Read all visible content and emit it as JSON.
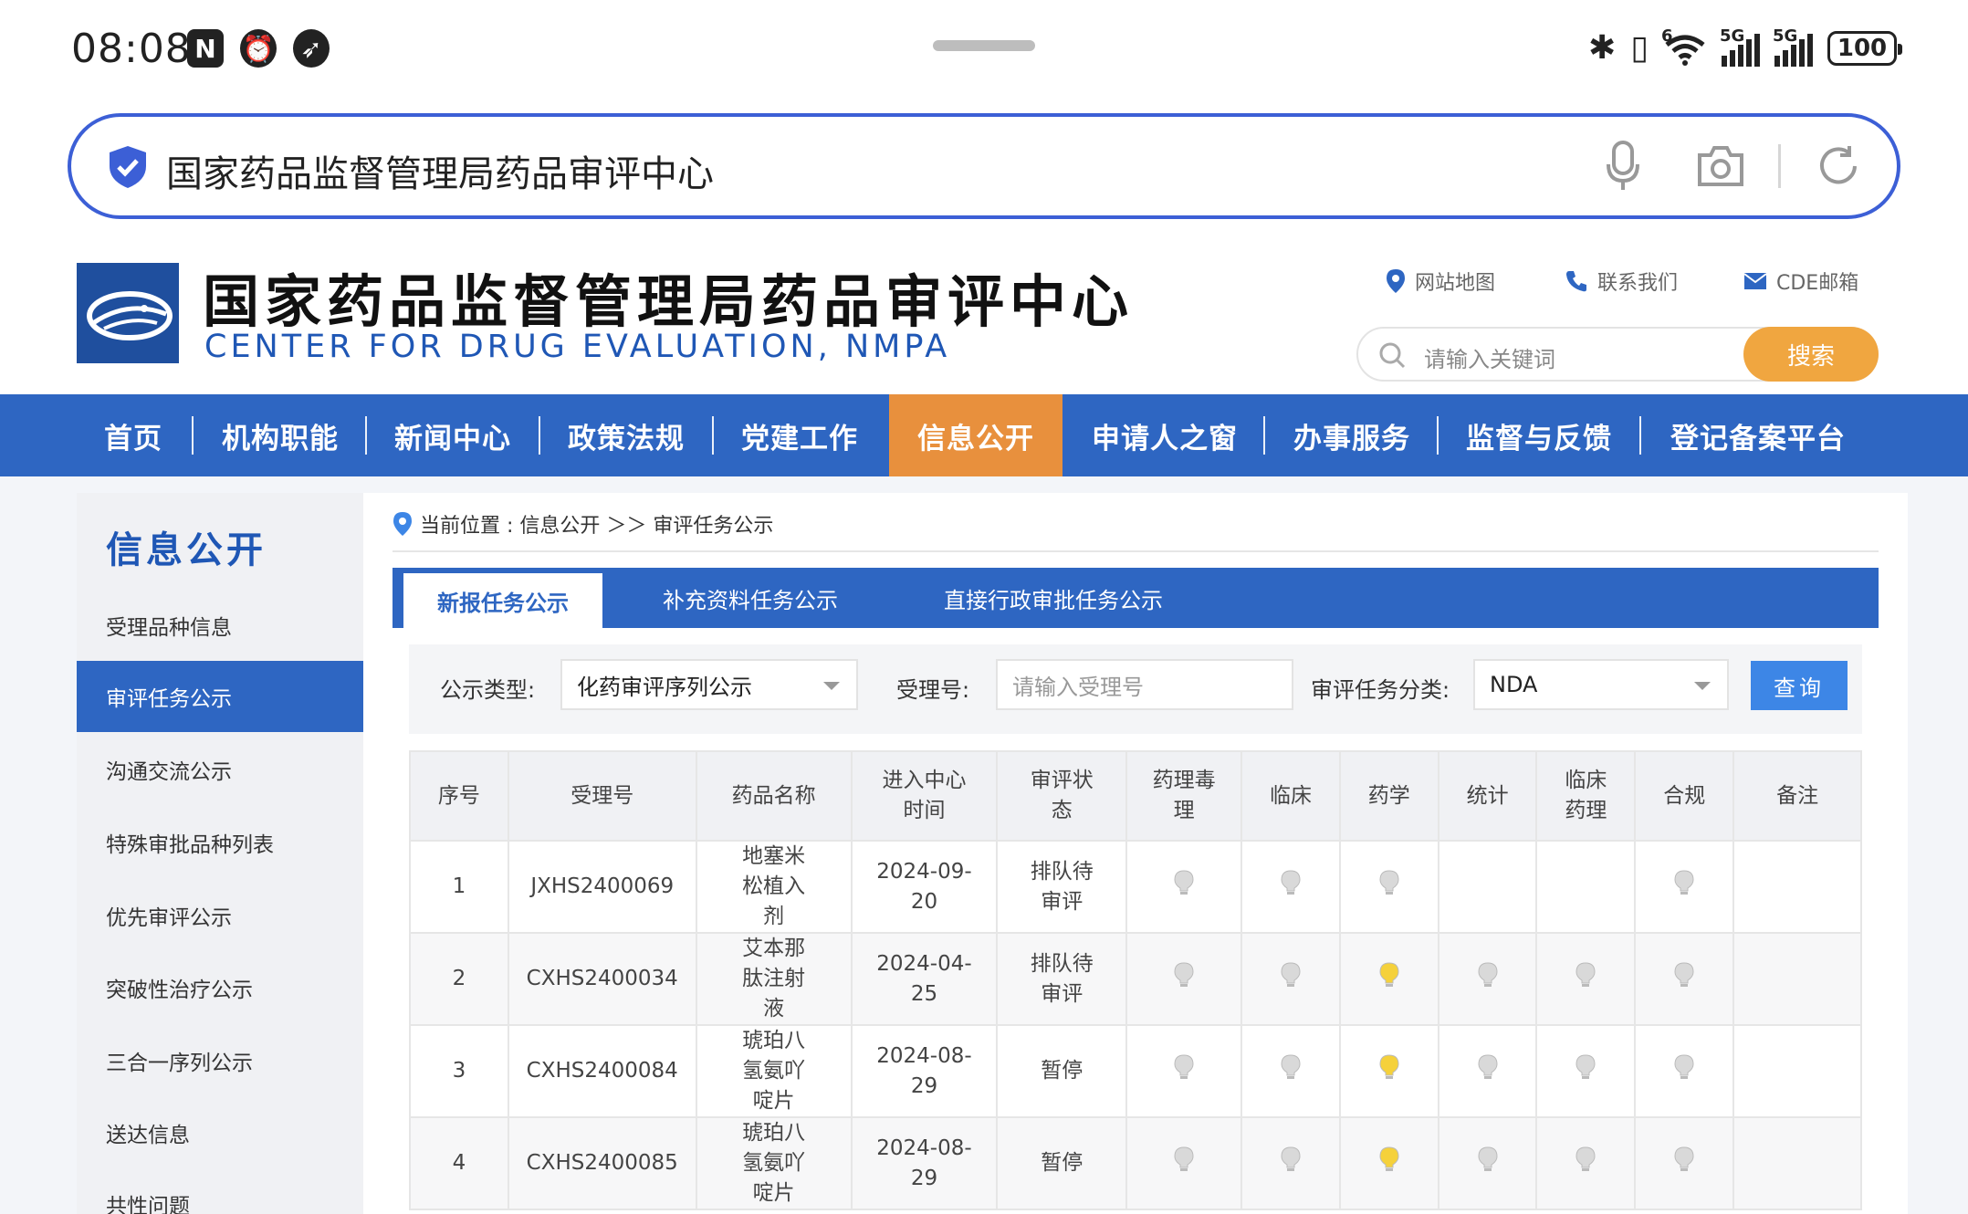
{
  "status_bar": {
    "time": "08:08",
    "left_icons": [
      "n-icon",
      "alarm-icon",
      "send-icon"
    ],
    "battery": "100",
    "signal_tags": [
      "5G",
      "5G"
    ],
    "wifi_tag": "6"
  },
  "browser": {
    "url_text": "国家药品监督管理局药品审评中心"
  },
  "site": {
    "title": "国家药品监督管理局药品审评中心",
    "subtitle": "CENTER FOR DRUG EVALUATION, NMPA",
    "links": {
      "sitemap": "网站地图",
      "contact": "联系我们",
      "mail": "CDE邮箱"
    },
    "search": {
      "placeholder": "请输入关键词",
      "button": "搜索"
    }
  },
  "nav": {
    "items": [
      "首页",
      "机构职能",
      "新闻中心",
      "政策法规",
      "党建工作",
      "信息公开",
      "申请人之窗",
      "办事服务",
      "监督与反馈",
      "登记备案平台"
    ],
    "active_index": 5
  },
  "sidebar": {
    "title": "信息公开",
    "items": [
      "受理品种信息",
      "审评任务公示",
      "沟通交流公示",
      "特殊审批品种列表",
      "优先审评公示",
      "突破性治疗公示",
      "三合一序列公示",
      "送达信息",
      "共性问题"
    ],
    "active_index": 1
  },
  "breadcrumb": {
    "label": "当前位置 : 信息公开 ＞＞ 审评任务公示"
  },
  "tabs": {
    "items": [
      "新报任务公示",
      "补充资料任务公示",
      "直接行政审批任务公示"
    ],
    "active_index": 0
  },
  "filter": {
    "type_label": "公示类型:",
    "type_value": "化药审评序列公示",
    "accept_label": "受理号:",
    "accept_placeholder": "请输入受理号",
    "category_label": "审评任务分类:",
    "category_value": "NDA",
    "query_button": "查询"
  },
  "table": {
    "headers": [
      "序号",
      "受理号",
      "药品名称",
      "进入中心时间",
      "审评状态",
      "药理毒理",
      "临床",
      "药学",
      "统计",
      "临床药理",
      "合规",
      "备注"
    ],
    "rows": [
      {
        "no": "1",
        "accept_no": "JXHS2400069",
        "name": "地塞米松植入剂",
        "time": "2024-09-20",
        "status": "排队待审评",
        "bulbs": [
          "off",
          "off",
          "off",
          "none",
          "none",
          "off"
        ],
        "note": ""
      },
      {
        "no": "2",
        "accept_no": "CXHS2400034",
        "name": "艾本那肽注射液",
        "time": "2024-04-25",
        "status": "排队待审评",
        "bulbs": [
          "off",
          "off",
          "on",
          "off",
          "off",
          "off"
        ],
        "note": ""
      },
      {
        "no": "3",
        "accept_no": "CXHS2400084",
        "name": "琥珀八氢氨吖啶片",
        "time": "2024-08-29",
        "status": "暂停",
        "bulbs": [
          "off",
          "off",
          "on",
          "off",
          "off",
          "off"
        ],
        "note": ""
      },
      {
        "no": "4",
        "accept_no": "CXHS2400085",
        "name": "琥珀八氢氨吖啶片",
        "time": "2024-08-29",
        "status": "暂停",
        "bulbs": [
          "off",
          "off",
          "on",
          "off",
          "off",
          "off"
        ],
        "note": ""
      }
    ]
  },
  "colors": {
    "primary_blue": "#2e66c2",
    "nav_active_orange": "#e8903d",
    "search_orange": "#f0a640",
    "query_blue": "#3d86e6",
    "bulb_on": "#f5d13b",
    "bulb_off": "#d9d9d9"
  }
}
